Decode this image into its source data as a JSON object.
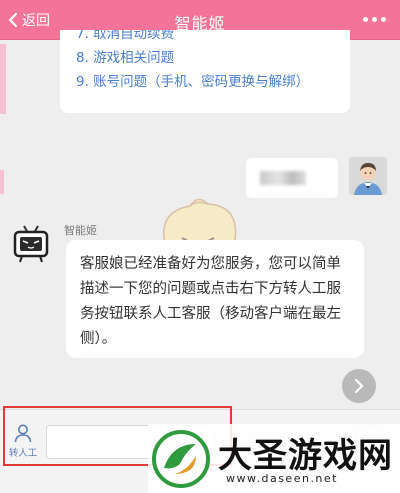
{
  "header": {
    "back_label": "返回",
    "title": "智能姬"
  },
  "menu": {
    "items": [
      "7. 取消自动续费",
      "8. 游戏相关问题",
      "9. 账号问题（手机、密码更换与解绑）"
    ]
  },
  "bot": {
    "name": "智能姬",
    "message": "客服娘已经准备好为您服务，您可以简单描述一下您的问题或点击右下方转人工服务按钮联系人工客服（移动客户端在最左侧）。"
  },
  "bottom": {
    "transfer_label": "转人工",
    "input_value": "",
    "input_placeholder": ""
  },
  "watermark": {
    "brand": "大圣游戏网",
    "url": "www.daseen.net"
  },
  "colors": {
    "header_bg": "#f47399",
    "menu_text": "#4a7fd1",
    "highlight_border": "#e23a3a"
  },
  "icons": {
    "back": "chevron-left-icon",
    "more": "more-dots-icon",
    "transfer": "person-icon",
    "next": "chevron-right-icon"
  }
}
